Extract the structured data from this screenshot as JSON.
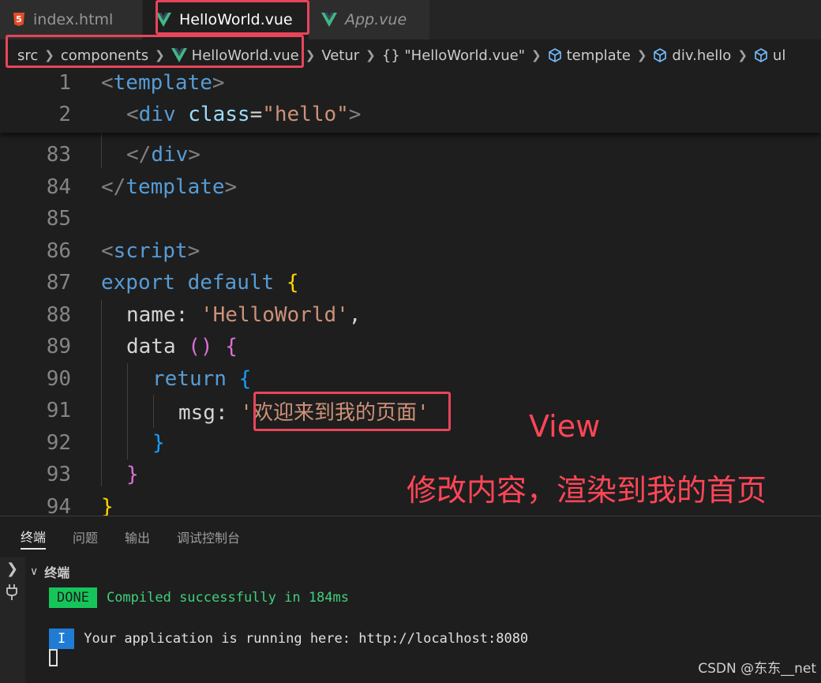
{
  "tabs": [
    {
      "label": "index.html",
      "icon": "html5-icon",
      "state": "inactive"
    },
    {
      "label": "HelloWorld.vue",
      "icon": "vue-icon",
      "state": "active",
      "close": "×"
    },
    {
      "label": "App.vue",
      "icon": "vue-icon",
      "state": "inactive-preview"
    }
  ],
  "breadcrumb": {
    "src": "src",
    "components": "components",
    "file": "HelloWorld.vue",
    "vetur": "Vetur",
    "obj": "{} \"HelloWorld.vue\"",
    "template": "template",
    "div": "div.hello",
    "ul": "ul"
  },
  "editor": {
    "sticky": [
      {
        "num": "1",
        "parts": [
          "<",
          "template",
          ">"
        ]
      },
      {
        "num": "2",
        "parts": [
          "<",
          "div",
          "class",
          "=",
          "\"hello\"",
          ">"
        ]
      }
    ],
    "lines": [
      {
        "num": "83",
        "parts": [
          "</",
          "div",
          ">"
        ]
      },
      {
        "num": "84",
        "parts": [
          "</",
          "template",
          ">"
        ]
      },
      {
        "num": "85"
      },
      {
        "num": "86",
        "parts": [
          "<",
          "script",
          ">"
        ]
      },
      {
        "num": "87",
        "parts": [
          "export",
          "default",
          "{"
        ]
      },
      {
        "num": "88",
        "parts": [
          "name",
          ":",
          "'HelloWorld'",
          ","
        ]
      },
      {
        "num": "89",
        "parts": [
          "data",
          "()",
          "{"
        ]
      },
      {
        "num": "90",
        "parts": [
          "return",
          "{"
        ]
      },
      {
        "num": "91",
        "parts": [
          "msg",
          ":",
          "'",
          "欢迎来到我的页面",
          "'"
        ]
      },
      {
        "num": "92",
        "parts": [
          "}"
        ]
      },
      {
        "num": "93",
        "parts": [
          "}"
        ]
      },
      {
        "num": "94",
        "parts": [
          "}"
        ]
      }
    ]
  },
  "annotations": {
    "view": "View",
    "caption": "修改内容，渲染到我的首页"
  },
  "panel": {
    "tabs": [
      "终端",
      "问题",
      "输出",
      "调试控制台"
    ],
    "active_tab": "终端",
    "terminal_title": "终端",
    "done_badge": "DONE",
    "done_text": "Compiled successfully in 184ms",
    "info_badge": "I",
    "info_text": "Your application is running here: http://localhost:8080"
  },
  "watermark": "CSDN @东东__net",
  "colors": {
    "accent_red": "#e8455a",
    "vue_green": "#41b883",
    "html_orange": "#e44d26"
  }
}
